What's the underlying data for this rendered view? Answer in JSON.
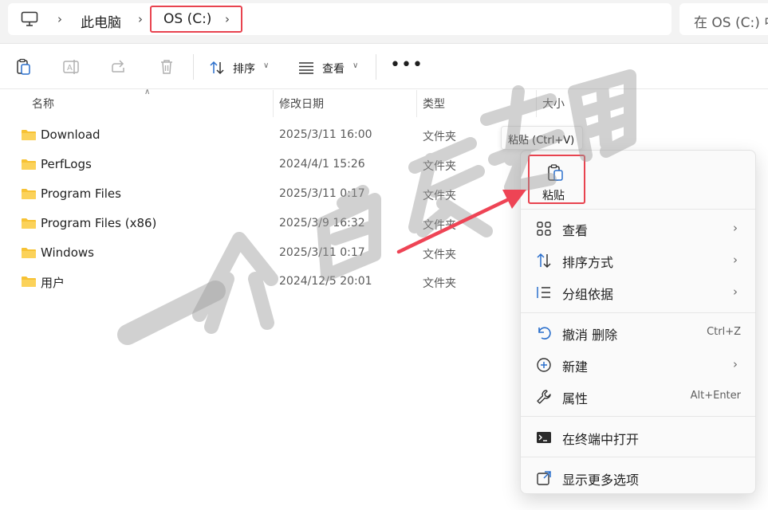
{
  "colors": {
    "highlight": "#e8434f",
    "folder": "#f7c234",
    "arrow": "#ee4455"
  },
  "address": {
    "root_icon": "computer-icon",
    "crumbs": [
      "此电脑",
      "OS (C:)"
    ],
    "search_placeholder": "在 OS (C:) 中搜索"
  },
  "toolbar": {
    "icons": [
      "copy-icon",
      "rename-icon",
      "share-icon",
      "delete-icon"
    ],
    "sort_label": "排序",
    "view_label": "查看",
    "more_icon": "more-dots-icon"
  },
  "columns": [
    "名称",
    "修改日期",
    "类型",
    "大小"
  ],
  "files": [
    {
      "name": "Download",
      "date": "2025/3/11 16:00",
      "type": "文件夹"
    },
    {
      "name": "PerfLogs",
      "date": "2024/4/1 15:26",
      "type": "文件夹"
    },
    {
      "name": "Program Files",
      "date": "2025/3/11 0:17",
      "type": "文件夹"
    },
    {
      "name": "Program Files (x86)",
      "date": "2025/3/9 16:32",
      "type": "文件夹"
    },
    {
      "name": "Windows",
      "date": "2025/3/11 0:17",
      "type": "文件夹"
    },
    {
      "name": "用户",
      "date": "2024/12/5 20:01",
      "type": "文件夹"
    }
  ],
  "tooltip": "粘贴 (Ctrl+V)",
  "context_menu": {
    "quick_paste": {
      "label": "粘贴",
      "icon": "paste-icon"
    },
    "items": [
      {
        "label": "查看",
        "icon": "grid-icon",
        "submenu": true
      },
      {
        "label": "排序方式",
        "icon": "sort-icon",
        "submenu": true
      },
      {
        "label": "分组依据",
        "icon": "group-list-icon",
        "submenu": true
      },
      {
        "label": "撤消 删除",
        "icon": "undo-icon",
        "shortcut": "Ctrl+Z"
      },
      {
        "label": "新建",
        "icon": "new-plus-icon",
        "submenu": true
      },
      {
        "label": "属性",
        "icon": "wrench-icon",
        "shortcut": "Alt+Enter"
      },
      {
        "label": "在终端中打开",
        "icon": "terminal-icon"
      },
      {
        "label": "显示更多选项",
        "icon": "share-out-icon"
      }
    ]
  },
  "watermark": "一介白衣专用"
}
